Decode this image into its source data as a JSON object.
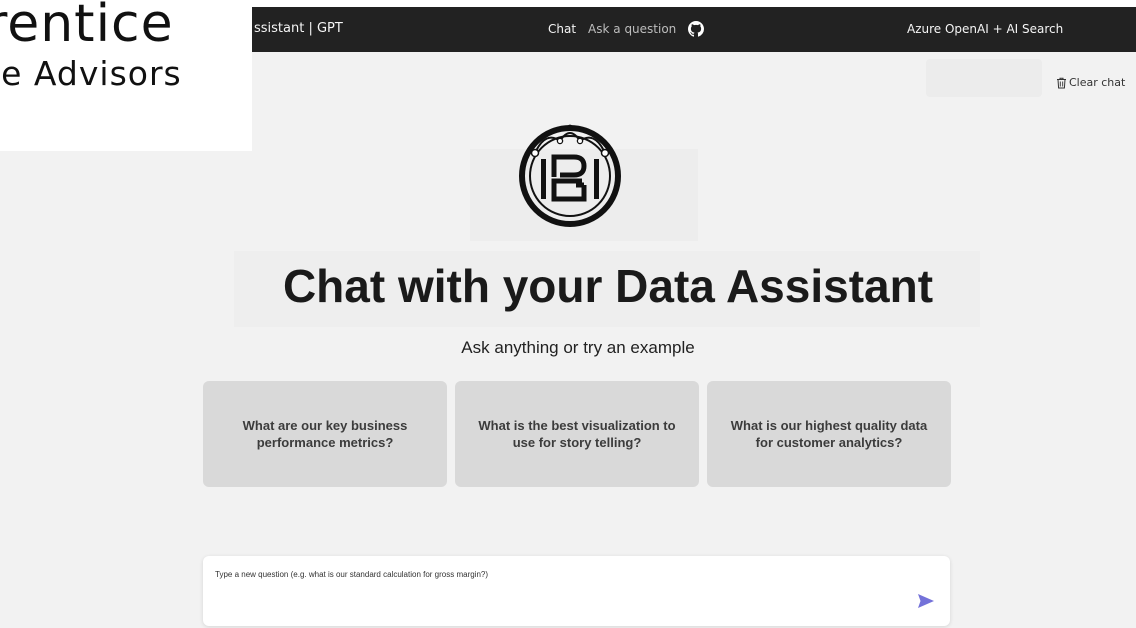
{
  "logo_overlay": {
    "line1": "rentice",
    "line2": "ce Advisors"
  },
  "header": {
    "title": "ssistant | GPT",
    "nav": [
      {
        "label": "Chat"
      },
      {
        "label": "Ask a question"
      }
    ],
    "github_icon": "github-icon",
    "right_title": "Azure OpenAI + AI Search"
  },
  "toolbar": {
    "clear_chat_label": "Clear chat",
    "clear_chat_icon": "trash-icon"
  },
  "hero": {
    "brand_logo_icon": "pgi-monogram-logo",
    "headline": "Chat with your Data Assistant",
    "subhead": "Ask anything or try an example"
  },
  "examples": [
    {
      "text": "What are our key business performance metrics?"
    },
    {
      "text": "What is the best visualization to use for story telling?"
    },
    {
      "text": "What is our highest quality data for customer analytics?"
    }
  ],
  "composer": {
    "placeholder": "Type a new question (e.g. what is our standard calculation for gross margin?)",
    "send_icon": "send-icon"
  },
  "colors": {
    "header_bg": "#222222",
    "page_bg": "#f2f2f2",
    "card_bg": "#d9d9d9",
    "send_accent": "#7472d9"
  }
}
